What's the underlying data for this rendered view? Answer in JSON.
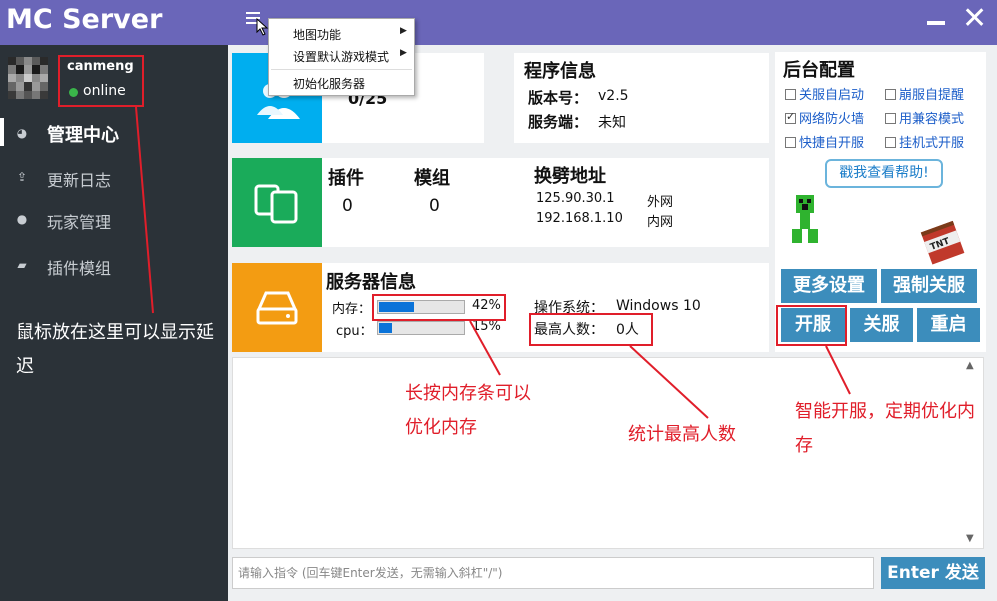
{
  "app": {
    "title": "MC Server"
  },
  "user": {
    "name": "canmeng",
    "status": "online"
  },
  "nav": [
    {
      "label": "管理中心",
      "icon": "dashboard-icon"
    },
    {
      "label": "更新日志",
      "icon": "upload-icon"
    },
    {
      "label": "玩家管理",
      "icon": "user-icon"
    },
    {
      "label": "插件模组",
      "icon": "book-icon"
    }
  ],
  "sidebar_tip": "鼠标放在这里可以显示延迟",
  "menu": {
    "items": [
      {
        "label": "地图功能",
        "has_submenu": true
      },
      {
        "label": "设置默认游戏模式",
        "has_submenu": true
      },
      {
        "label": "初始化服务器",
        "has_submenu": false
      }
    ]
  },
  "players_card": {
    "count": "0/25"
  },
  "program_info": {
    "title": "程序信息",
    "version_label": "版本号：",
    "version": "v2.5",
    "server_label": "服务端：",
    "server": "未知"
  },
  "plugins_card": {
    "plugins_label": "插件",
    "plugins_count": "0",
    "mods_label": "模组",
    "mods_count": "0",
    "address_title": "换劈地址",
    "external_ip": "125.90.30.1",
    "external_label": "外网",
    "internal_ip": "192.168.1.10",
    "internal_label": "内网"
  },
  "server_info": {
    "title": "服务器信息",
    "mem_label": "内存：",
    "mem_value": "42%",
    "mem_fraction": 0.42,
    "cpu_label": "cpu：",
    "cpu_value": "15%",
    "cpu_fraction": 0.15,
    "os_label": "操作系统：",
    "os": "Windows 10",
    "max_players_label": "最高人数：",
    "max_players": "0人"
  },
  "backend": {
    "title": "后台配置",
    "options": [
      {
        "label": "关服自启动",
        "checked": false
      },
      {
        "label": "崩服自提醒",
        "checked": false
      },
      {
        "label": "网络防火墙",
        "checked": true
      },
      {
        "label": "用兼容模式",
        "checked": false
      },
      {
        "label": "快捷自开服",
        "checked": false
      },
      {
        "label": "挂机式开服",
        "checked": false
      }
    ],
    "help": "戳我查看帮助!",
    "more_settings": "更多设置",
    "force_stop": "强制关服",
    "start": "开服",
    "stop": "关服",
    "restart": "重启"
  },
  "command": {
    "placeholder": "请输入指令 (回车键Enter发送，无需输入斜杠\"/\")",
    "send": "Enter 发送"
  },
  "annotations": {
    "memory": "长按内存条可以优化内存",
    "max_players": "统计最高人数",
    "start": "智能开服，定期优化内存"
  },
  "colors": {
    "header": "#6a66b9",
    "sidebar": "#2b3238",
    "players_tile": "#00aeef",
    "plugins_tile": "#1aab5a",
    "server_tile": "#f39c12",
    "button": "#3c8dbc",
    "annotation": "#e01e2a"
  }
}
